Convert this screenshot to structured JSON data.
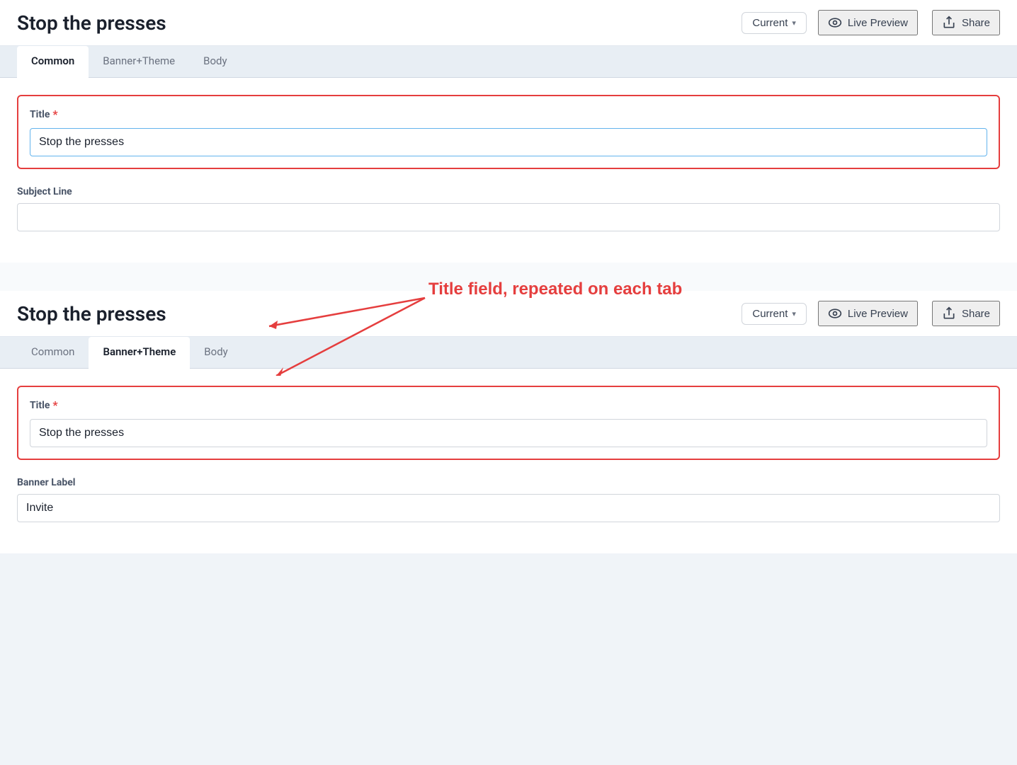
{
  "page": {
    "title": "Stop the presses",
    "version_label": "Current",
    "version_chevron": "▾",
    "live_preview_label": "Live Preview",
    "share_label": "Share"
  },
  "section1": {
    "tabs": [
      {
        "id": "common",
        "label": "Common",
        "active": true
      },
      {
        "id": "banner-theme",
        "label": "Banner+Theme",
        "active": false
      },
      {
        "id": "body",
        "label": "Body",
        "active": false
      }
    ],
    "title_field": {
      "label": "Title",
      "value": "Stop the presses",
      "placeholder": ""
    },
    "subject_line_field": {
      "label": "Subject Line",
      "value": "",
      "placeholder": ""
    }
  },
  "section2": {
    "tabs": [
      {
        "id": "common",
        "label": "Common",
        "active": false
      },
      {
        "id": "banner-theme",
        "label": "Banner+Theme",
        "active": true
      },
      {
        "id": "body",
        "label": "Body",
        "active": false
      }
    ],
    "title_field": {
      "label": "Title",
      "value": "Stop the presses",
      "placeholder": ""
    },
    "banner_label_field": {
      "label": "Banner Label",
      "value": "Invite",
      "placeholder": ""
    }
  },
  "annotation": {
    "text": "Title field, repeated on each tab"
  },
  "icons": {
    "eye": "👁",
    "share": "↪"
  },
  "colors": {
    "red_border": "#e53e3e",
    "blue_input": "#63b3ed",
    "text_dark": "#1a202c",
    "text_gray": "#6b7280",
    "tab_bg": "#e8eef4",
    "label_color": "#4a5568"
  }
}
